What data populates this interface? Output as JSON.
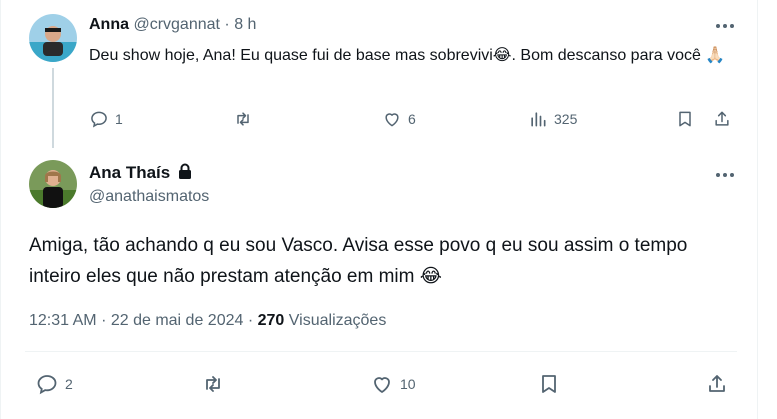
{
  "reply": {
    "author_name": "Anna",
    "author_handle": "@crvgannat",
    "separator": "·",
    "time_ago": "8 h",
    "text_part1": "Deu show hoje, Ana! Eu quase fui de base mas sobrevivi",
    "emoji1": "😂",
    "text_part2": ". Bom descanso para você",
    "emoji2": "🙏🏻",
    "replies": "1",
    "retweets": "",
    "likes": "6",
    "views": "325"
  },
  "main": {
    "author_name": "Ana Thaís",
    "author_handle": "@anathaismatos",
    "text": "Amiga, tão achando q eu sou Vasco. Avisa esse povo q eu sou assim o tempo inteiro eles que não prestam atenção em mim",
    "emoji": "😂",
    "time": "12:31 AM",
    "separator": "·",
    "date": "22 de mai de 2024",
    "separator2": "·",
    "views_count": "270",
    "views_label": "Visualizações",
    "replies": "2",
    "retweets": "",
    "likes": "10"
  },
  "colors": {
    "text": "#0f1419",
    "muted": "#536471",
    "border": "#eff3f4"
  }
}
